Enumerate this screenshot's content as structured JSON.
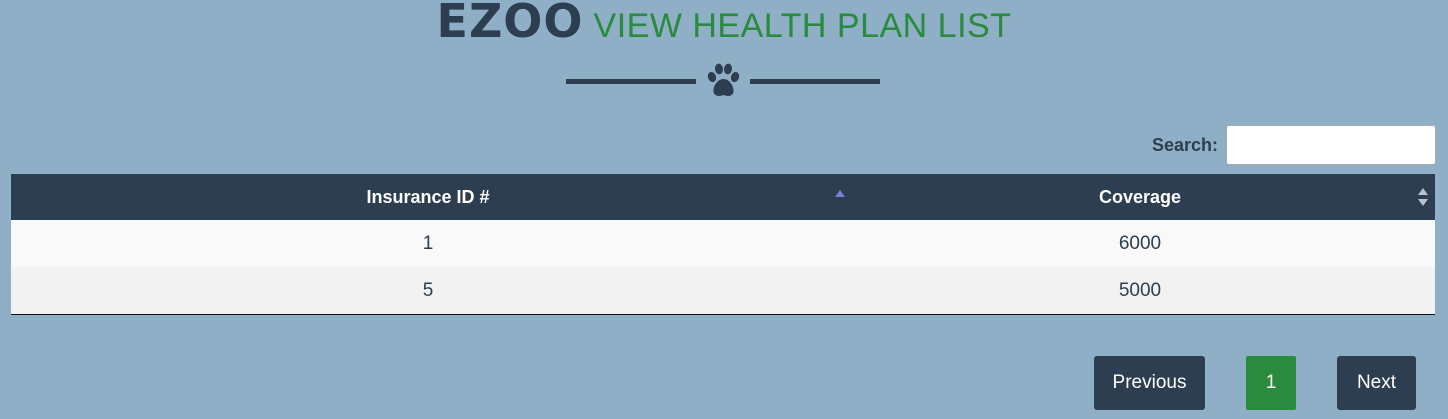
{
  "header": {
    "brand": "EZOO",
    "subtitle": "VIEW HEALTH PLAN LIST"
  },
  "search": {
    "label": "Search:",
    "value": ""
  },
  "table": {
    "columns": [
      "Insurance ID #",
      "Coverage"
    ],
    "sort": {
      "column": "Insurance ID #",
      "direction": "ascending"
    },
    "rows": [
      {
        "insurance_id": "1",
        "coverage": "6000"
      },
      {
        "insurance_id": "5",
        "coverage": "5000"
      }
    ]
  },
  "pagination": {
    "previous_label": "Previous",
    "current_page": "1",
    "next_label": "Next"
  },
  "colors": {
    "background": "#8fafc6",
    "primary_dark": "#2c3e50",
    "accent_green": "#2a8a3e",
    "sort_indicator": "#7b7fd6"
  },
  "icons": {
    "divider": "paw-icon",
    "sort_asc": "sort-ascending-icon",
    "sort_both": "sort-both-icon"
  }
}
